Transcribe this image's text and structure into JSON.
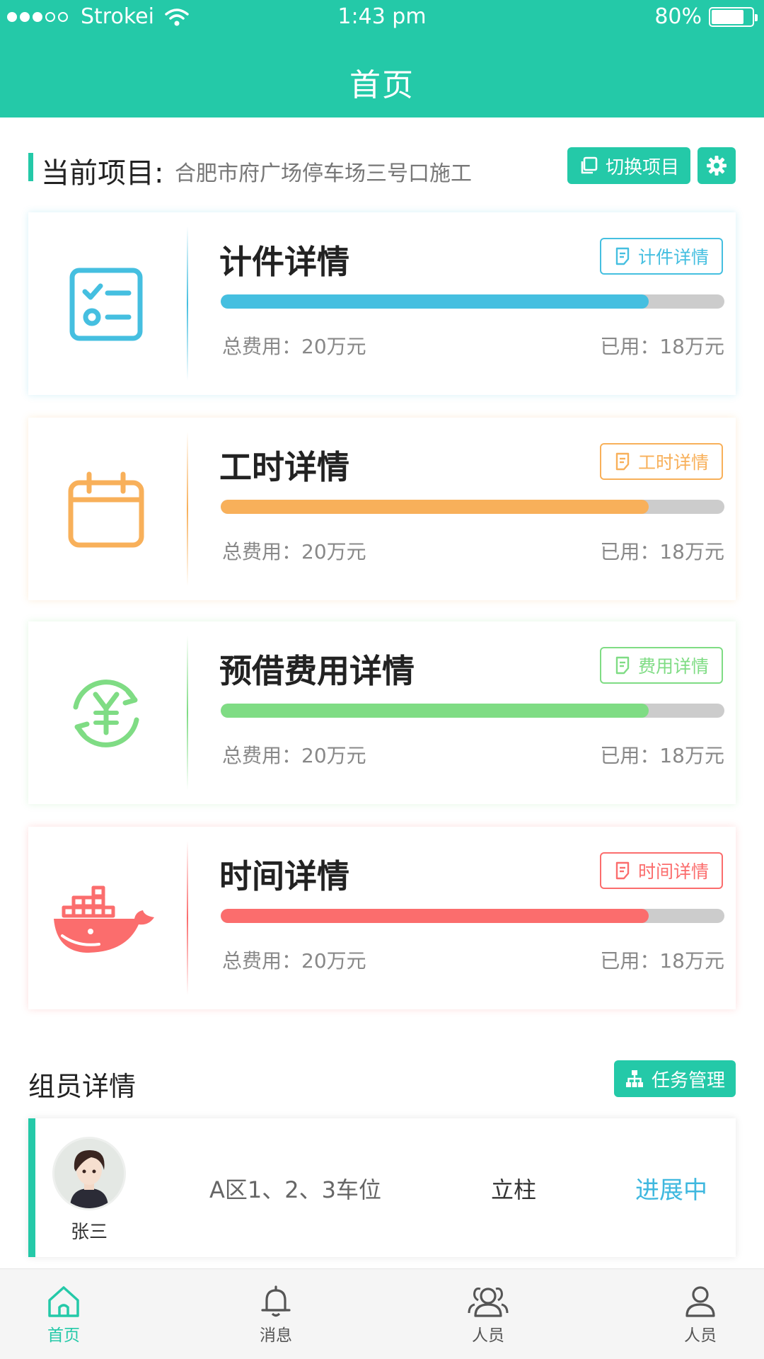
{
  "status_bar": {
    "carrier": "Strokei",
    "time": "1:43 pm",
    "battery": "80%",
    "battery_level": 0.8
  },
  "header": {
    "title": "首页"
  },
  "project": {
    "label": "当前项目:",
    "name": "合肥市府广场停车场三号口施工",
    "switch_label": "切换项目",
    "settings_icon": "gear-icon"
  },
  "colors": {
    "brand": "#24c9a8",
    "blue": "#45bfe0",
    "orange": "#f8b05a",
    "green": "#7fdc84",
    "red": "#fb6d6d",
    "track": "#cccccc"
  },
  "cards": [
    {
      "id": "piece",
      "title": "计件详情",
      "button": "计件详情",
      "icon": "checklist-icon",
      "total": "总费用：20万元",
      "used": "已用：18万元",
      "progress": 0.85,
      "color": "#45bfe0"
    },
    {
      "id": "hours",
      "title": "工时详情",
      "button": "工时详情",
      "icon": "calendar-icon",
      "total": "总费用：20万元",
      "used": "已用：18万元",
      "progress": 0.85,
      "color": "#f8b05a"
    },
    {
      "id": "advance",
      "title": "预借费用详情",
      "button": "费用详情",
      "icon": "yuan-cycle-icon",
      "total": "总费用：20万元",
      "used": "已用：18万元",
      "progress": 0.85,
      "color": "#7fdc84"
    },
    {
      "id": "time",
      "title": "时间详情",
      "button": "时间详情",
      "icon": "whale-ship-icon",
      "total": "总费用：20万元",
      "used": "已用：18万元",
      "progress": 0.85,
      "color": "#fb6d6d"
    }
  ],
  "members": {
    "section_title": "组员详情",
    "task_button": "任务管理",
    "rows": [
      {
        "name": "张三",
        "area": "A区1、2、3车位",
        "task": "立柱",
        "status": "进展中"
      }
    ]
  },
  "tabs": [
    {
      "label": "首页",
      "icon": "home-icon",
      "active": true
    },
    {
      "label": "消息",
      "icon": "bell-icon",
      "active": false
    },
    {
      "label": "人员",
      "icon": "group-icon",
      "active": false
    },
    {
      "label": "人员",
      "icon": "person-icon",
      "active": false
    }
  ]
}
